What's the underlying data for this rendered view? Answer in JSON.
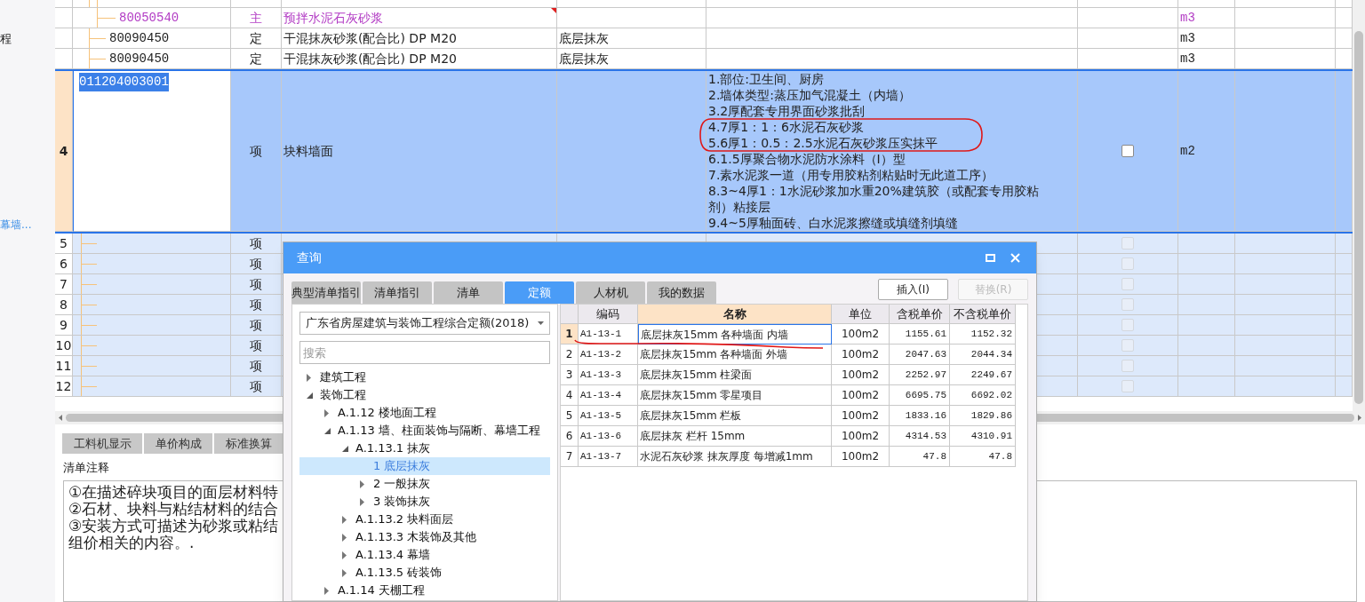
{
  "sidebar": {
    "items": [
      {
        "label": "程",
        "kind": "text"
      },
      {
        "label": "幕墙...",
        "kind": "link"
      }
    ]
  },
  "grid": {
    "upper_rows": [
      {
        "kind": "cut",
        "children": [
          {
            "kind": "material",
            "code": "80050540",
            "type": "主",
            "name": "预拌水泥石灰砂浆",
            "unit": "m3",
            "flag": true
          }
        ]
      },
      {
        "kind": "quota",
        "code": "80090450",
        "type": "定",
        "name": "干混抹灰砂浆(配合比) DP M20",
        "feature": "底层抹灰",
        "unit": "m3",
        "flag": false
      },
      {
        "kind": "quota",
        "code": "80090450",
        "type": "定",
        "name": "干混抹灰砂浆(配合比) DP M20",
        "feature": "底层抹灰",
        "unit": "m3",
        "flag": false
      }
    ],
    "item": {
      "row_number": "4",
      "code": "011204003001",
      "type": "项",
      "name": "块料墙面",
      "selected": true,
      "checked": false,
      "unit": "m2",
      "description": [
        "1.部位:卫生间、厨房",
        "2.墙体类型:蒸压加气混凝土（内墙）",
        "3.2厚配套专用界面砂浆批刮",
        "4.7厚1：1：6水泥石灰砂浆",
        "5.6厚1：0.5：2.5水泥石灰砂浆压实抹平",
        "6.1.5厚聚合物水泥防水涂料（I）型",
        "7.素水泥浆一道（用专用胶粘剂粘贴时无此道工序）",
        "8.3~4厚1：1水泥砂浆加水重20%建筑胶（或配套专用胶粘",
        "剂）粘接层",
        "9.4~5厚釉面砖、白水泥浆擦缝或填缝剂填缝"
      ]
    },
    "empty_rows": [
      {
        "row_number": "5",
        "type": "项",
        "checked": false,
        "disabled": true
      },
      {
        "row_number": "6",
        "type": "项",
        "checked": false,
        "disabled": true
      },
      {
        "row_number": "7",
        "type": "项",
        "checked": false,
        "disabled": true
      },
      {
        "row_number": "8",
        "type": "项",
        "checked": false,
        "disabled": true
      },
      {
        "row_number": "9",
        "type": "项",
        "checked": false,
        "disabled": true
      },
      {
        "row_number": "10",
        "type": "项",
        "checked": false,
        "disabled": true
      },
      {
        "row_number": "11",
        "type": "项",
        "checked": false,
        "disabled": true
      },
      {
        "row_number": "12",
        "type": "项",
        "checked": false,
        "disabled": true
      }
    ]
  },
  "bottom_panel": {
    "tabs": [
      {
        "label": "工料机显示",
        "selected": false
      },
      {
        "label": "单价构成",
        "selected": false
      },
      {
        "label": "标准换算",
        "selected": false
      }
    ],
    "notes_label": "清单注释",
    "notes_lines": [
      "①在描述碎块项目的面层材料特",
      "②石材、块料与粘结材料的结合",
      "③安装方式可描述为砂浆或粘结",
      "组价相关的内容。."
    ]
  },
  "dialog": {
    "title": "查询",
    "tabs": [
      {
        "label": "典型清单指引",
        "selected": false
      },
      {
        "label": "清单指引",
        "selected": false
      },
      {
        "label": "清单",
        "selected": false
      },
      {
        "label": "定额",
        "selected": true
      },
      {
        "label": "人材机",
        "selected": false
      },
      {
        "label": "我的数据",
        "selected": false
      }
    ],
    "buttons": [
      {
        "label": "插入(I)",
        "disabled": false
      },
      {
        "label": "替换(R)",
        "disabled": true
      }
    ],
    "library": "广东省房屋建筑与装饰工程综合定额(2018)",
    "search": {
      "placeholder": "搜索"
    },
    "tree": [
      {
        "label": "建筑工程",
        "kind": "folder",
        "expanded": false,
        "selected": false
      },
      {
        "label": "装饰工程",
        "kind": "folder",
        "expanded": true,
        "selected": false,
        "children": [
          {
            "label": "A.1.12 楼地面工程",
            "kind": "folder",
            "expanded": false,
            "selected": false
          },
          {
            "label": "A.1.13 墙、柱面装饰与隔断、幕墙工程",
            "kind": "folder",
            "expanded": true,
            "selected": false,
            "children": [
              {
                "label": "A.1.13.1 抹灰",
                "kind": "folder",
                "expanded": true,
                "selected": false,
                "children": [
                  {
                    "label": "1 底层抹灰",
                    "kind": "leaf",
                    "selected": true
                  },
                  {
                    "label": "2 一般抹灰",
                    "kind": "folder",
                    "expanded": false,
                    "selected": false
                  },
                  {
                    "label": "3 装饰抹灰",
                    "kind": "folder",
                    "expanded": false,
                    "selected": false
                  }
                ]
              },
              {
                "label": "A.1.13.2 块料面层",
                "kind": "folder",
                "expanded": false,
                "selected": false
              },
              {
                "label": "A.1.13.3 木装饰及其他",
                "kind": "folder",
                "expanded": false,
                "selected": false
              },
              {
                "label": "A.1.13.4 幕墙",
                "kind": "folder",
                "expanded": false,
                "selected": false
              },
              {
                "label": "A.1.13.5 砖装饰",
                "kind": "folder",
                "expanded": false,
                "selected": false
              }
            ]
          },
          {
            "label": "A.1.14 天棚工程",
            "kind": "folder",
            "expanded": false,
            "selected": false
          }
        ]
      }
    ],
    "table": {
      "columns": [
        {
          "label": "编码",
          "selected": false
        },
        {
          "label": "名称",
          "selected": true
        },
        {
          "label": "单位",
          "selected": false
        },
        {
          "label": "含税单价",
          "selected": false
        },
        {
          "label": "不含税单价",
          "selected": false
        }
      ],
      "rows": [
        {
          "row_number": "1",
          "code": "A1-13-1",
          "name": "底层抹灰15mm 各种墙面 内墙",
          "unit": "100m2",
          "price_with_tax": "1155.61",
          "price_without_tax": "1152.32",
          "selected": true
        },
        {
          "row_number": "2",
          "code": "A1-13-2",
          "name": "底层抹灰15mm 各种墙面 外墙",
          "unit": "100m2",
          "price_with_tax": "2047.63",
          "price_without_tax": "2044.34",
          "selected": false
        },
        {
          "row_number": "3",
          "code": "A1-13-3",
          "name": "底层抹灰15mm 柱梁面",
          "unit": "100m2",
          "price_with_tax": "2252.97",
          "price_without_tax": "2249.67",
          "selected": false
        },
        {
          "row_number": "4",
          "code": "A1-13-4",
          "name": "底层抹灰15mm 零星项目",
          "unit": "100m2",
          "price_with_tax": "6695.75",
          "price_without_tax": "6692.02",
          "selected": false
        },
        {
          "row_number": "5",
          "code": "A1-13-5",
          "name": "底层抹灰15mm 栏板",
          "unit": "100m2",
          "price_with_tax": "1833.16",
          "price_without_tax": "1829.86",
          "selected": false
        },
        {
          "row_number": "6",
          "code": "A1-13-6",
          "name": "底层抹灰 栏杆 15mm",
          "unit": "100m2",
          "price_with_tax": "4314.53",
          "price_without_tax": "4310.91",
          "selected": false
        },
        {
          "row_number": "7",
          "code": "A1-13-7",
          "name": "水泥石灰砂浆 抹灰厚度 每增减1mm",
          "unit": "100m2",
          "price_with_tax": "47.8",
          "price_without_tax": "47.8",
          "selected": false
        }
      ]
    }
  }
}
